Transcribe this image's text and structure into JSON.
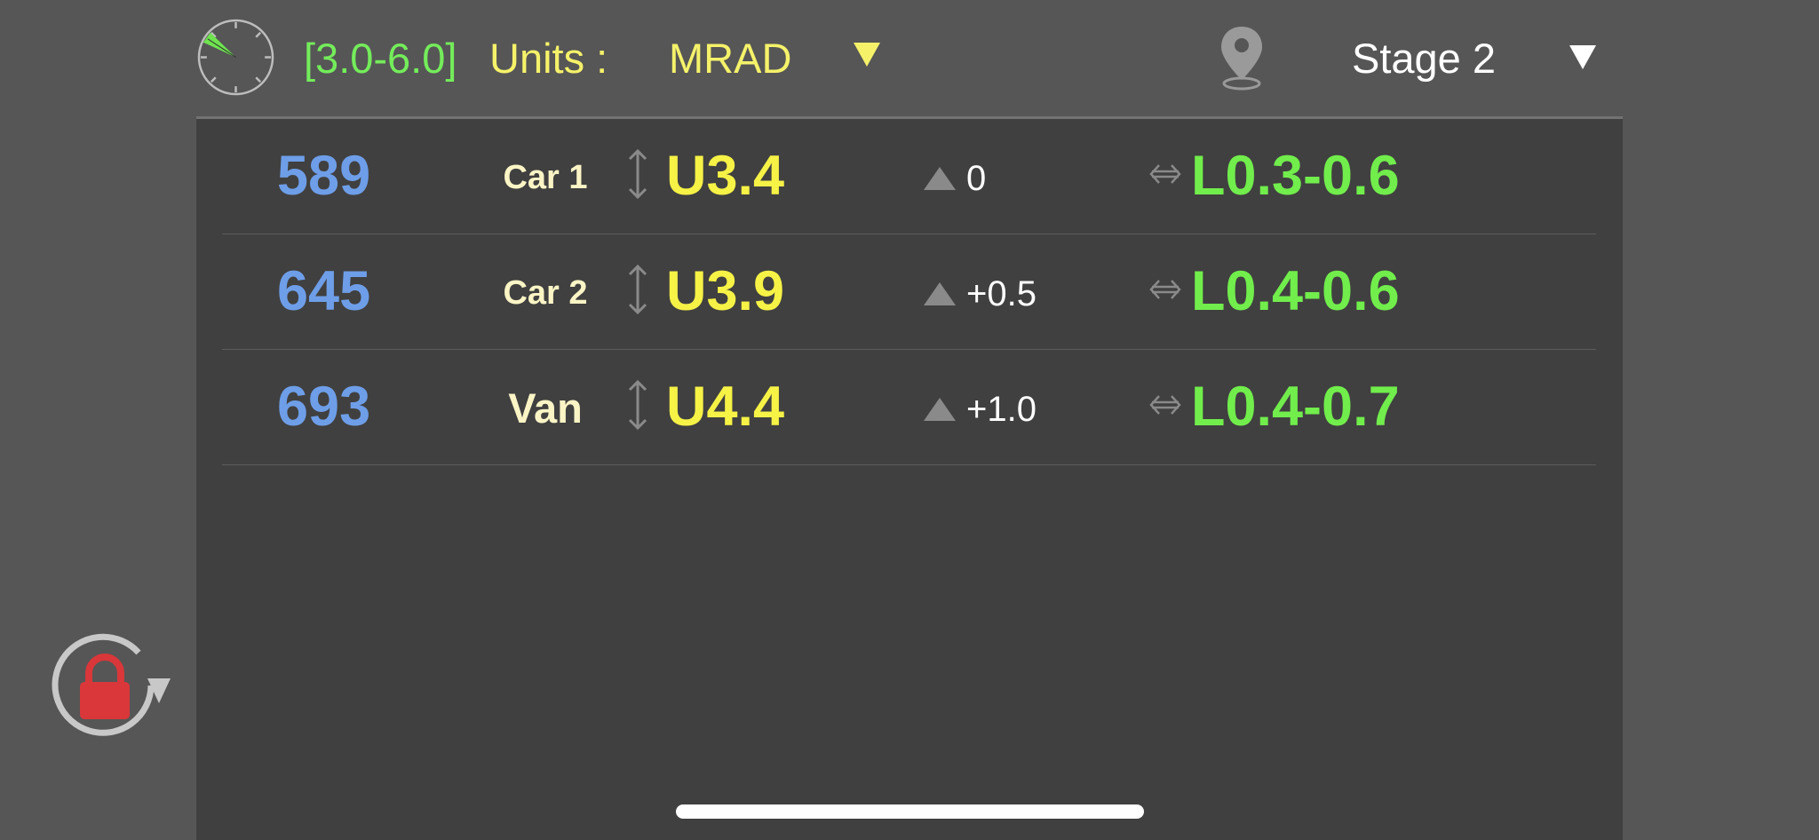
{
  "header": {
    "range": "[3.0-6.0]",
    "units_label": "Units :",
    "units_value": "MRAD",
    "stage_value": "Stage 2"
  },
  "icons": {
    "timer": "stopwatch-icon",
    "units_dropdown": "triangle-down-icon",
    "location": "map-pin-icon",
    "stage_dropdown": "triangle-down-icon",
    "vertical": "vertical-arrow-icon",
    "adjustment": "triangle-up-icon",
    "horizontal": "horizontal-arrow-icon",
    "rotation_lock": "rotation-lock-icon"
  },
  "colors": {
    "background": "#565656",
    "panel": "#404040",
    "range": "#74ec5b",
    "units": "#f5f26a",
    "distance": "#6e9ee8",
    "elevation": "#f6f246",
    "windage": "#71ed4c",
    "target": "#fbf5c6",
    "lock": "#d9373a"
  },
  "rows": [
    {
      "distance": "589",
      "target": "Car 1",
      "elevation": "U3.4",
      "adjustment": "0",
      "windage": "L0.3-0.6"
    },
    {
      "distance": "645",
      "target": "Car 2",
      "elevation": "U3.9",
      "adjustment": "+0.5",
      "windage": "L0.4-0.6"
    },
    {
      "distance": "693",
      "target": "Van",
      "elevation": "U4.4",
      "adjustment": "+1.0",
      "windage": "L0.4-0.7"
    }
  ]
}
